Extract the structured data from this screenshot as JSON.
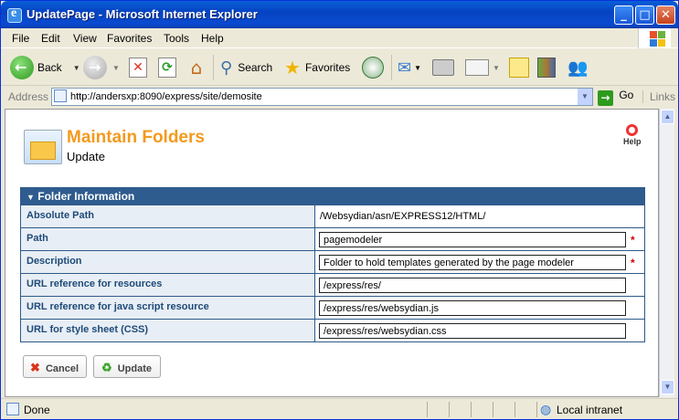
{
  "window": {
    "title": "UpdatePage - Microsoft Internet Explorer"
  },
  "menu": [
    "File",
    "Edit",
    "View",
    "Favorites",
    "Tools",
    "Help"
  ],
  "toolbar": {
    "back": "Back",
    "search": "Search",
    "favorites": "Favorites"
  },
  "address": {
    "label": "Address",
    "url": "http://andersxp:8090/express/site/demosite",
    "go": "Go",
    "links": "Links"
  },
  "page": {
    "title": "Maintain Folders",
    "subtitle": "Update",
    "help": "Help"
  },
  "panel": {
    "header": "Folder Information",
    "rows": [
      {
        "label": "Absolute Path",
        "value": "/Websydian/asn/EXPRESS12/HTML/"
      },
      {
        "label": "Path",
        "value": "pagemodeler"
      },
      {
        "label": "Description",
        "value": "Folder to hold templates generated by the page modeler"
      },
      {
        "label": "URL reference for resources",
        "value": "/express/res/"
      },
      {
        "label": "URL reference for java script resource",
        "value": "/express/res/websydian.js"
      },
      {
        "label": "URL for style sheet (CSS)",
        "value": "/express/res/websydian.css"
      }
    ]
  },
  "buttons": {
    "cancel": "Cancel",
    "update": "Update"
  },
  "status": {
    "text": "Done",
    "zone": "Local intranet"
  }
}
